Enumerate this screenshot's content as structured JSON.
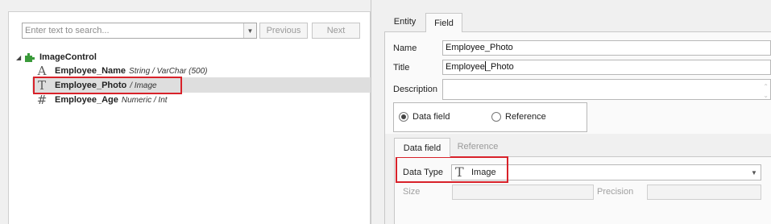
{
  "search": {
    "placeholder": "Enter text to search...",
    "prev_label": "Previous",
    "next_label": "Next"
  },
  "tree": {
    "root": {
      "label": "ImageControl",
      "expander": "◢"
    },
    "fields": [
      {
        "icon": "A",
        "name": "Employee_Name",
        "desc": "String / VarChar (500)",
        "selected": false
      },
      {
        "icon": "T",
        "name": "Employee_Photo",
        "desc": "/ Image",
        "selected": true
      },
      {
        "icon": "#",
        "name": "Employee_Age",
        "desc": "Numeric / Int",
        "selected": false
      }
    ]
  },
  "tabs": {
    "entity": "Entity",
    "field": "Field",
    "active": "Field"
  },
  "form": {
    "name_label": "Name",
    "name_value": "Employee_Photo",
    "title_label": "Title",
    "title_value_before": "Employee",
    "title_value_after": "_Photo",
    "desc_label": "Description",
    "desc_value": ""
  },
  "field_kind": {
    "data_field": "Data field",
    "reference": "Reference",
    "selected": "Data field"
  },
  "sub_tabs": {
    "data_field": "Data field",
    "reference": "Reference",
    "active": "Data field"
  },
  "data_type": {
    "label": "Data Type",
    "value": "Image",
    "icon": "T"
  },
  "size": {
    "label": "Size",
    "value": ""
  },
  "precision": {
    "label": "Precision",
    "value": ""
  },
  "icons": {
    "dropdown": "▼",
    "spin_up": "⌃",
    "spin_down": "⌄"
  },
  "colors": {
    "highlight": "#d8222a",
    "selection": "#dedede",
    "puzzle": "#3a9a3a"
  }
}
